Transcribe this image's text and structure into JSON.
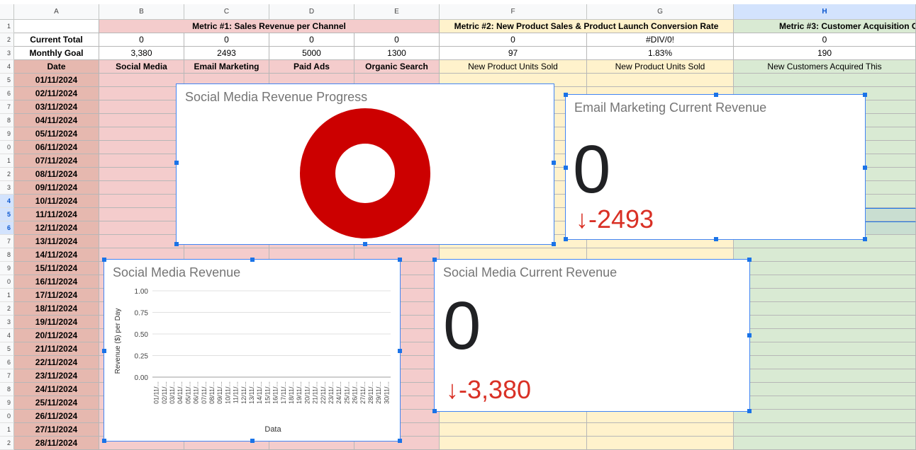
{
  "columns": [
    "A",
    "B",
    "C",
    "D",
    "E",
    "F",
    "G",
    "H"
  ],
  "header_row": {
    "metric1": "Metric #1: Sales Revenue per Channel",
    "metric2": "Metric #2: New Product Sales & Product Launch Conversion Rate",
    "metric3": "Metric #3: Customer Acquisition C"
  },
  "current_total": {
    "label": "Current Total",
    "values": [
      "0",
      "0",
      "0",
      "0",
      "0",
      "#DIV/0!",
      "0"
    ]
  },
  "monthly_goal": {
    "label": "Monthly Goal",
    "values": [
      "3,380",
      "2493",
      "5000",
      "1300",
      "97",
      "1.83%",
      "190"
    ]
  },
  "labels_row": {
    "label": "Date",
    "values": [
      "Social Media",
      "Email Marketing",
      "Paid Ads",
      "Organic Search",
      "New Product Units Sold",
      "New Product Units Sold",
      "New Customers Acquired This"
    ]
  },
  "dates": [
    "01/11/2024",
    "02/11/2024",
    "03/11/2024",
    "04/11/2024",
    "05/11/2024",
    "06/11/2024",
    "07/11/2024",
    "08/11/2024",
    "09/11/2024",
    "10/11/2024",
    "11/11/2024",
    "12/11/2024",
    "13/11/2024",
    "14/11/2024",
    "15/11/2024",
    "16/11/2024",
    "17/11/2024",
    "18/11/2024",
    "19/11/2024",
    "20/11/2024",
    "21/11/2024",
    "22/11/2024",
    "23/11/2024",
    "24/11/2024",
    "25/11/2024",
    "26/11/2024",
    "27/11/2024",
    "28/11/2024"
  ],
  "row_numbers": [
    "1",
    "2",
    "3",
    "4",
    "5",
    "6",
    "7",
    "8",
    "9",
    "0",
    "1",
    "2",
    "3",
    "4",
    "5",
    "6",
    "7",
    "8",
    "9",
    "0",
    "1",
    "2",
    "3",
    "4",
    "5",
    "6",
    "7",
    "8",
    "9",
    "0",
    "1",
    "2"
  ],
  "colors": {
    "donut": "#cc0000",
    "delta": "#d93025",
    "selection": "#4285f4"
  },
  "charts": {
    "progress": {
      "title": "Social Media Revenue Progress"
    },
    "email": {
      "title": "Email Marketing Current Revenue",
      "value": "0",
      "delta": "-2493"
    },
    "social_current": {
      "title": "Social Media Current Revenue",
      "value": "0",
      "delta": "-3,380"
    },
    "social_revenue": {
      "title": "Social Media Revenue",
      "ylabel": "Revenue ($) per Day",
      "xlabel": "Data"
    }
  },
  "chart_data": {
    "type": "bar",
    "title": "Social Media Revenue",
    "xlabel": "Data",
    "ylabel": "Revenue ($) per Day",
    "ylim": [
      0,
      1.0
    ],
    "yticks": [
      "1.00",
      "0.75",
      "0.50",
      "0.25",
      "0.00"
    ],
    "categories": [
      "01/11/...",
      "02/11/...",
      "03/11/...",
      "04/11/...",
      "05/11/...",
      "06/11/...",
      "07/11/...",
      "08/11/...",
      "09/11/...",
      "10/11/...",
      "11/11/...",
      "12/11/...",
      "13/11/...",
      "14/11/...",
      "15/11/...",
      "16/11/...",
      "17/11/...",
      "18/11/...",
      "19/11/...",
      "20/11/...",
      "21/11/...",
      "22/11/...",
      "23/11/...",
      "24/11/...",
      "25/11/...",
      "26/11/...",
      "27/11/...",
      "28/11/...",
      "29/11/...",
      "30/11/..."
    ],
    "values": [
      0,
      0,
      0,
      0,
      0,
      0,
      0,
      0,
      0,
      0,
      0,
      0,
      0,
      0,
      0,
      0,
      0,
      0,
      0,
      0,
      0,
      0,
      0,
      0,
      0,
      0,
      0,
      0,
      0,
      0
    ],
    "grid": true
  }
}
